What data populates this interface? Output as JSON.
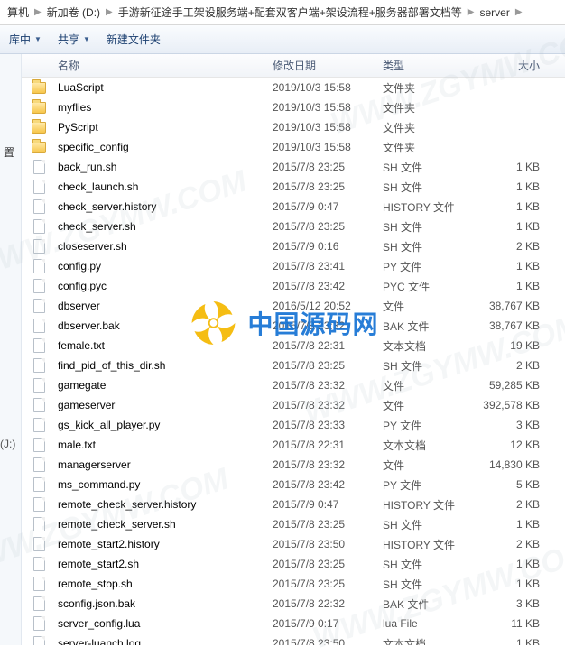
{
  "breadcrumb": {
    "items": [
      "算机",
      "新加卷 (D:)",
      "手游新征途手工架设服务端+配套双客户端+架设流程+服务器部署文档等",
      "server"
    ]
  },
  "toolbar": {
    "organize": "库中",
    "share": "共享",
    "newfolder": "新建文件夹"
  },
  "sidebar": {
    "label1": "置",
    "label2": "(J:)"
  },
  "columns": {
    "name": "名称",
    "date": "修改日期",
    "type": "类型",
    "size": "大小"
  },
  "watermark": {
    "text": "中国源码网",
    "bg": "WWW.ZGYMW.COM"
  },
  "files": [
    {
      "name": "LuaScript",
      "date": "2019/10/3 15:58",
      "type": "文件夹",
      "size": "",
      "icon": "folder"
    },
    {
      "name": "myflies",
      "date": "2019/10/3 15:58",
      "type": "文件夹",
      "size": "",
      "icon": "folder"
    },
    {
      "name": "PyScript",
      "date": "2019/10/3 15:58",
      "type": "文件夹",
      "size": "",
      "icon": "folder"
    },
    {
      "name": "specific_config",
      "date": "2019/10/3 15:58",
      "type": "文件夹",
      "size": "",
      "icon": "folder"
    },
    {
      "name": "back_run.sh",
      "date": "2015/7/8 23:25",
      "type": "SH 文件",
      "size": "1 KB",
      "icon": "file"
    },
    {
      "name": "check_launch.sh",
      "date": "2015/7/8 23:25",
      "type": "SH 文件",
      "size": "1 KB",
      "icon": "file"
    },
    {
      "name": "check_server.history",
      "date": "2015/7/9 0:47",
      "type": "HISTORY 文件",
      "size": "1 KB",
      "icon": "file"
    },
    {
      "name": "check_server.sh",
      "date": "2015/7/8 23:25",
      "type": "SH 文件",
      "size": "1 KB",
      "icon": "file"
    },
    {
      "name": "closeserver.sh",
      "date": "2015/7/9 0:16",
      "type": "SH 文件",
      "size": "2 KB",
      "icon": "file"
    },
    {
      "name": "config.py",
      "date": "2015/7/8 23:41",
      "type": "PY 文件",
      "size": "1 KB",
      "icon": "file"
    },
    {
      "name": "config.pyc",
      "date": "2015/7/8 23:42",
      "type": "PYC 文件",
      "size": "1 KB",
      "icon": "file"
    },
    {
      "name": "dbserver",
      "date": "2016/5/12 20:52",
      "type": "文件",
      "size": "38,767 KB",
      "icon": "file"
    },
    {
      "name": "dbserver.bak",
      "date": "2015/7/8 23:32",
      "type": "BAK 文件",
      "size": "38,767 KB",
      "icon": "file"
    },
    {
      "name": "female.txt",
      "date": "2015/7/8 22:31",
      "type": "文本文档",
      "size": "19 KB",
      "icon": "file"
    },
    {
      "name": "find_pid_of_this_dir.sh",
      "date": "2015/7/8 23:25",
      "type": "SH 文件",
      "size": "2 KB",
      "icon": "file"
    },
    {
      "name": "gamegate",
      "date": "2015/7/8 23:32",
      "type": "文件",
      "size": "59,285 KB",
      "icon": "file"
    },
    {
      "name": "gameserver",
      "date": "2015/7/8 23:32",
      "type": "文件",
      "size": "392,578 KB",
      "icon": "file"
    },
    {
      "name": "gs_kick_all_player.py",
      "date": "2015/7/8 23:33",
      "type": "PY 文件",
      "size": "3 KB",
      "icon": "file"
    },
    {
      "name": "male.txt",
      "date": "2015/7/8 22:31",
      "type": "文本文档",
      "size": "12 KB",
      "icon": "file"
    },
    {
      "name": "managerserver",
      "date": "2015/7/8 23:32",
      "type": "文件",
      "size": "14,830 KB",
      "icon": "file"
    },
    {
      "name": "ms_command.py",
      "date": "2015/7/8 23:42",
      "type": "PY 文件",
      "size": "5 KB",
      "icon": "file"
    },
    {
      "name": "remote_check_server.history",
      "date": "2015/7/9 0:47",
      "type": "HISTORY 文件",
      "size": "2 KB",
      "icon": "file"
    },
    {
      "name": "remote_check_server.sh",
      "date": "2015/7/8 23:25",
      "type": "SH 文件",
      "size": "1 KB",
      "icon": "file"
    },
    {
      "name": "remote_start2.history",
      "date": "2015/7/8 23:50",
      "type": "HISTORY 文件",
      "size": "2 KB",
      "icon": "file"
    },
    {
      "name": "remote_start2.sh",
      "date": "2015/7/8 23:25",
      "type": "SH 文件",
      "size": "1 KB",
      "icon": "file"
    },
    {
      "name": "remote_stop.sh",
      "date": "2015/7/8 23:25",
      "type": "SH 文件",
      "size": "1 KB",
      "icon": "file"
    },
    {
      "name": "sconfig.json.bak",
      "date": "2015/7/8 22:32",
      "type": "BAK 文件",
      "size": "3 KB",
      "icon": "file"
    },
    {
      "name": "server_config.lua",
      "date": "2015/7/9 0:17",
      "type": "lua File",
      "size": "11 KB",
      "icon": "file"
    },
    {
      "name": "server-luanch.log",
      "date": "2015/7/8 23:50",
      "type": "文本文档",
      "size": "1 KB",
      "icon": "file"
    }
  ]
}
